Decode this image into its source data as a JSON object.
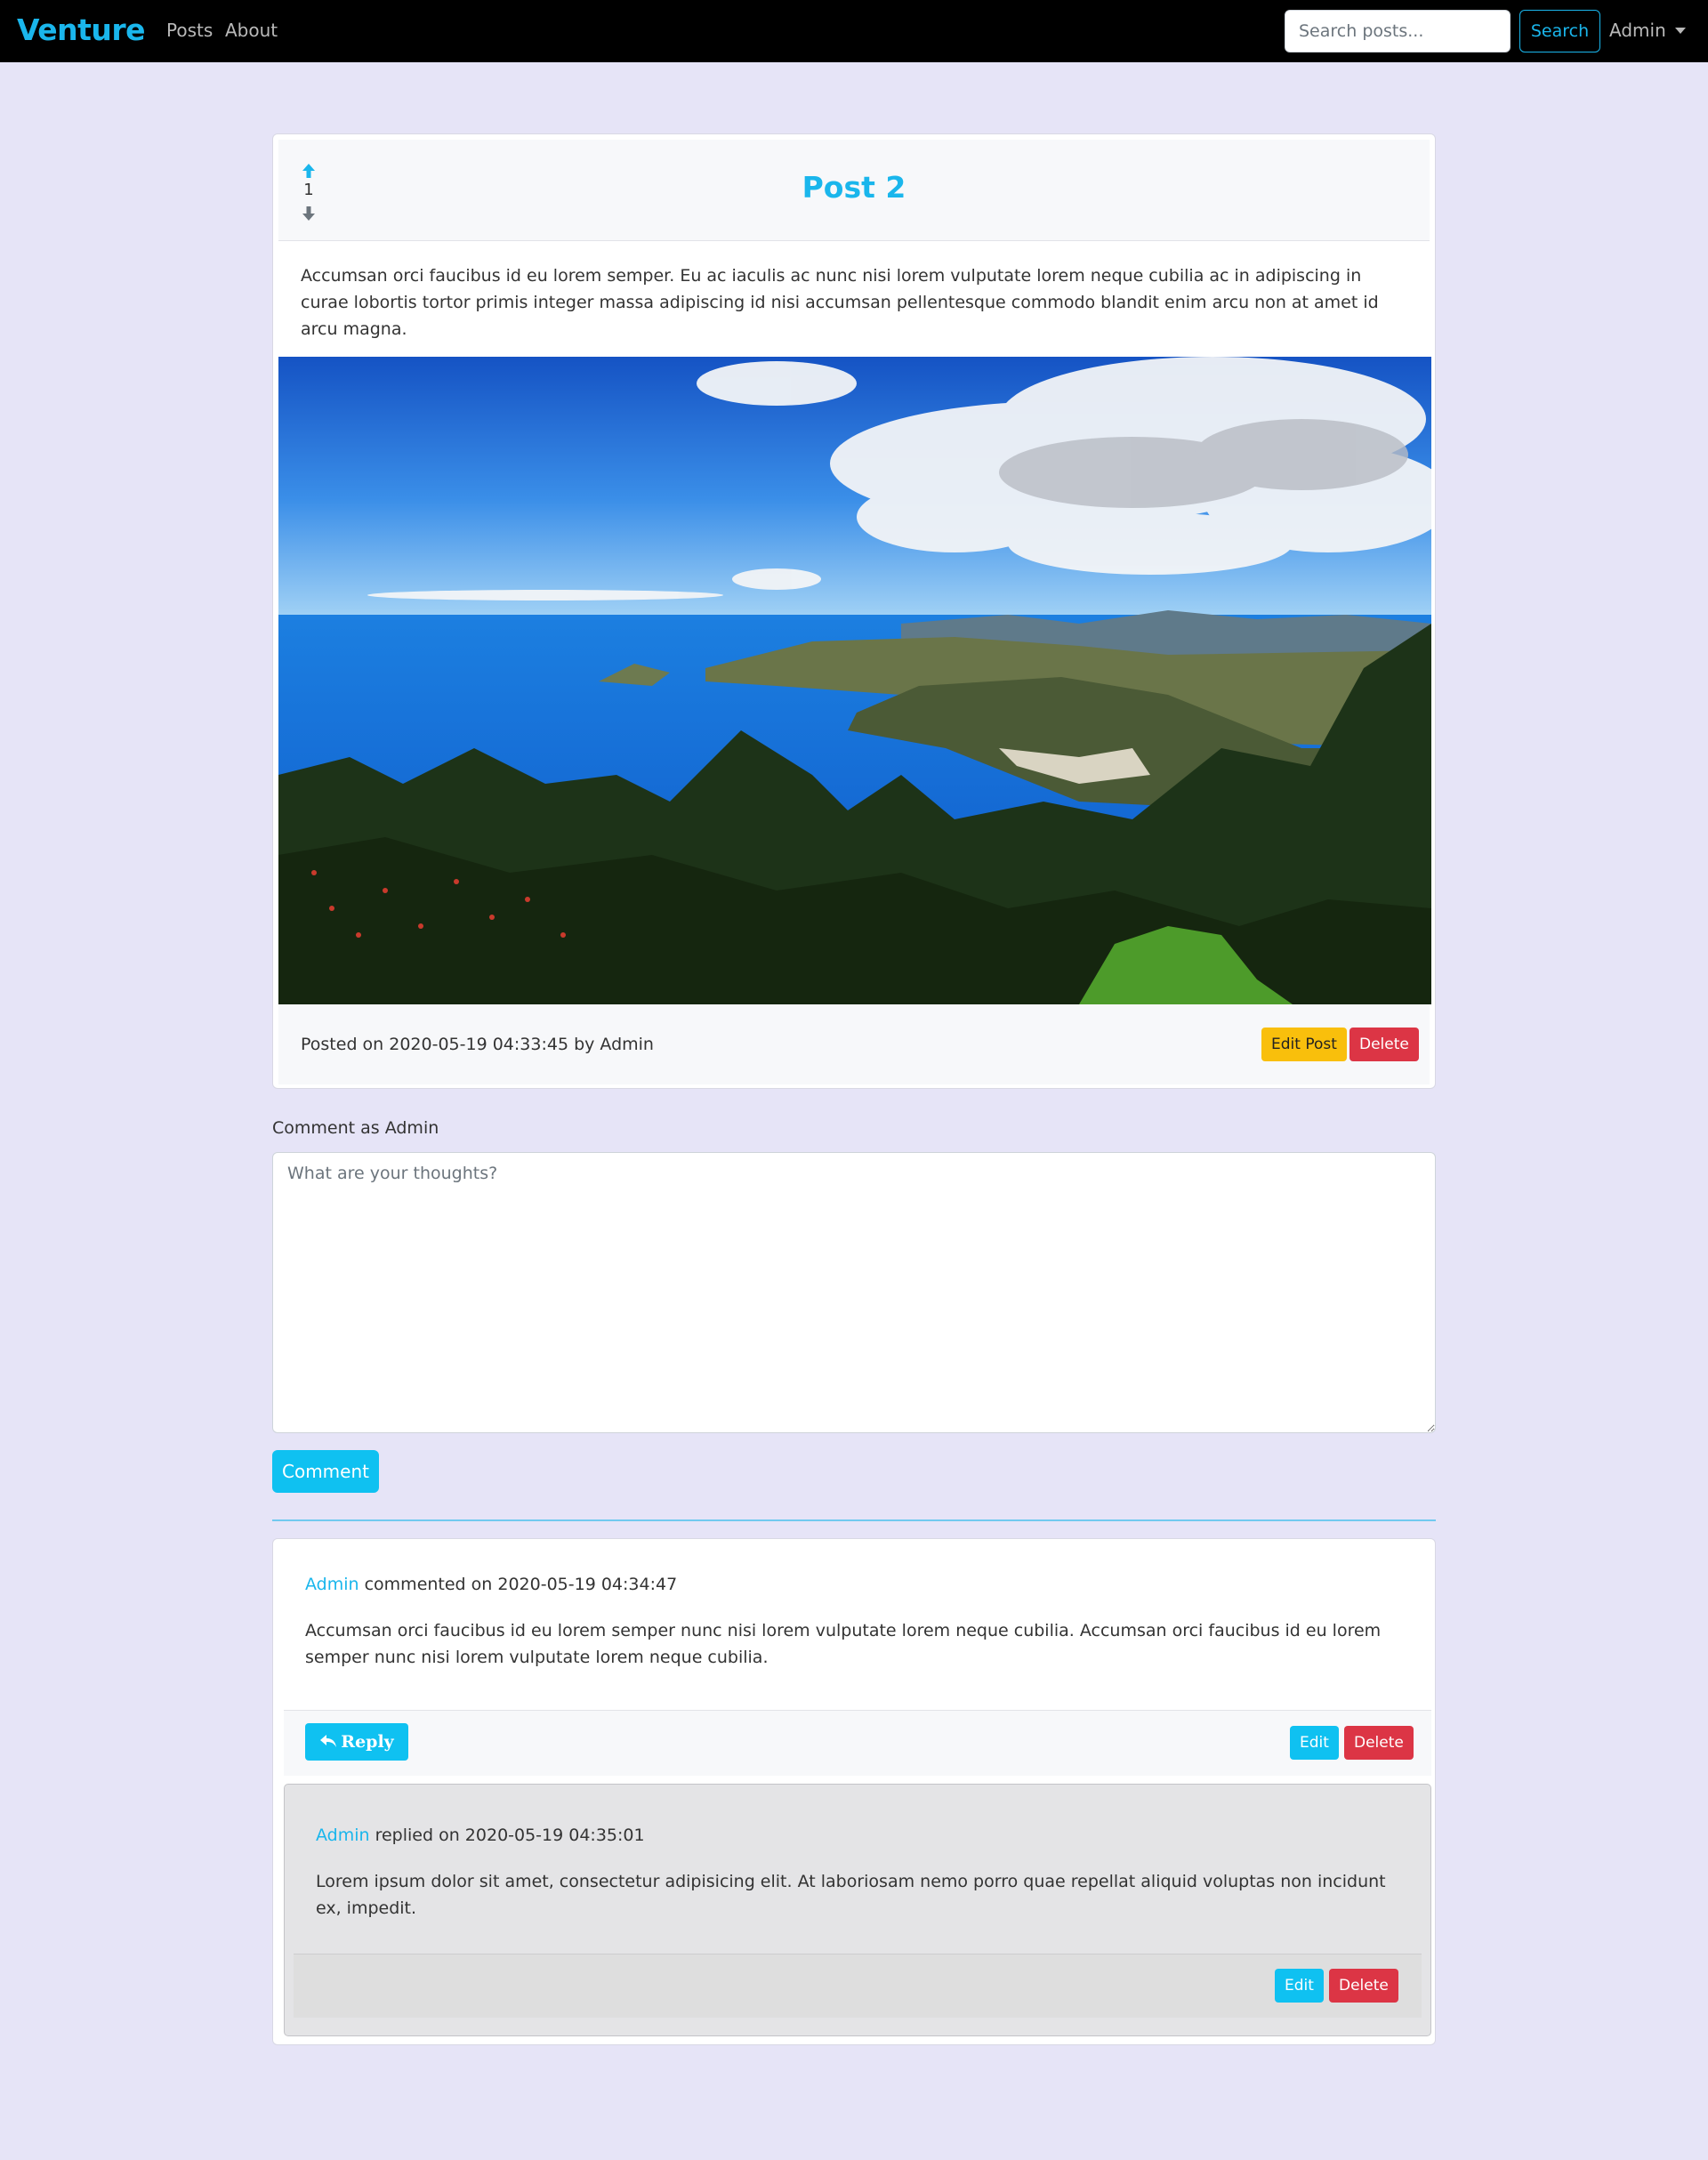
{
  "navbar": {
    "brand": "Venture",
    "links": [
      "Posts",
      "About"
    ],
    "search_placeholder": "Search posts...",
    "search_label": "Search",
    "user_menu": "Admin"
  },
  "post": {
    "votes": "1",
    "title": "Post 2",
    "body": "Accumsan orci faucibus id eu lorem semper. Eu ac iaculis ac nunc nisi lorem vulputate lorem neque cubilia ac in adipiscing in curae lobortis tortor primis integer massa adipiscing id nisi accumsan pellentesque commodo blandit enim arcu non at amet id arcu magna.",
    "posted_on": "Posted on 2020-05-19 04:33:45 by Admin",
    "edit_label": "Edit Post",
    "delete_label": "Delete"
  },
  "comment_form": {
    "label": "Comment as Admin",
    "placeholder": "What are your thoughts?",
    "submit_label": "Comment"
  },
  "comments": [
    {
      "author": "Admin",
      "meta": " commented on 2020-05-19 04:34:47",
      "text": "Accumsan orci faucibus id eu lorem semper nunc nisi lorem vulputate lorem neque cubilia. Accumsan orci faucibus id eu lorem semper nunc nisi lorem vulputate lorem neque cubilia.",
      "reply_label": "Reply",
      "edit_label": "Edit",
      "delete_label": "Delete",
      "replies": [
        {
          "author": "Admin",
          "meta": " replied on 2020-05-19 04:35:01",
          "text": "Lorem ipsum dolor sit amet, consectetur adipisicing elit. At laboriosam nemo porro quae repellat aliquid voluptas non incidunt ex, impedit.",
          "edit_label": "Edit",
          "delete_label": "Delete"
        }
      ]
    }
  ],
  "colors": {
    "accent": "#1ab6ec",
    "page_bg": "#e6e4f7",
    "warning": "#f9bf0c",
    "danger": "#dc3545"
  }
}
